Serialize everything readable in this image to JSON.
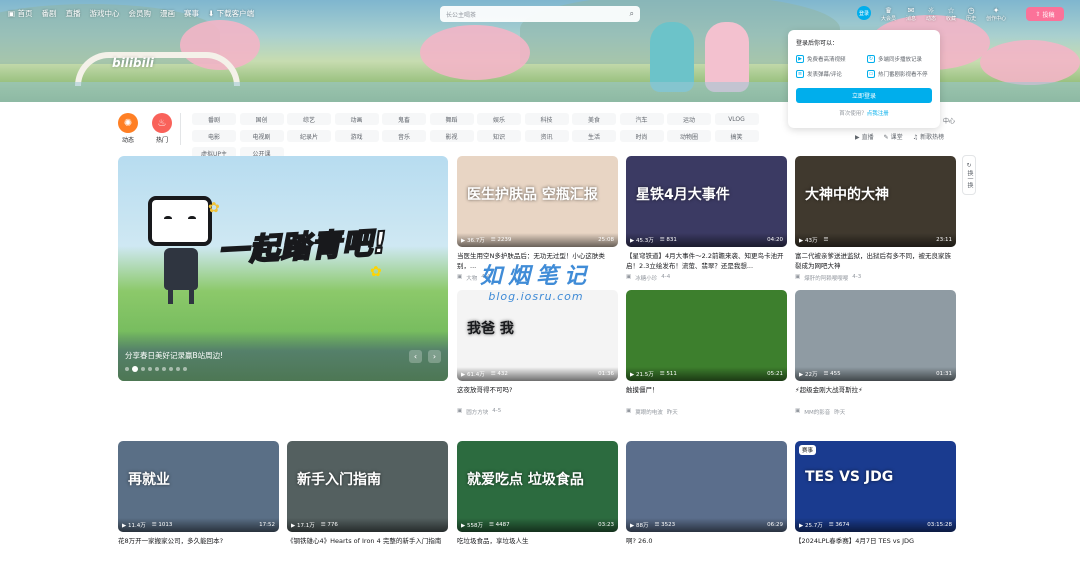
{
  "nav": {
    "items": [
      "首页",
      "番剧",
      "直播",
      "游戏中心",
      "会员购",
      "漫画",
      "赛事",
      "下载客户端"
    ],
    "search_placeholder": "长公主喝茶",
    "login_label": "登录",
    "right_items": [
      "大会员",
      "消息",
      "动态",
      "收藏",
      "历史",
      "创作中心"
    ],
    "upload_label": "投稿"
  },
  "logo_text": "bilibili",
  "channels": [
    {
      "label": "动态",
      "color": "#ff7f24"
    },
    {
      "label": "热门",
      "color": "#f9625a"
    }
  ],
  "tags": [
    "番剧",
    "国创",
    "综艺",
    "动画",
    "鬼畜",
    "舞蹈",
    "娱乐",
    "科技",
    "美食",
    "汽车",
    "运动",
    "VLOG",
    "电影",
    "电视剧",
    "纪录片",
    "游戏",
    "音乐",
    "影视",
    "知识",
    "资讯",
    "生活",
    "时尚",
    "动物圈",
    "搞笑",
    "虚拟UP主",
    "公开课"
  ],
  "extra_links": [
    "直播",
    "课堂",
    "新歌热榜"
  ],
  "popup": {
    "title": "登录后你可以：",
    "features": [
      "免费看高清视频",
      "多端同步播放记录",
      "发表弹幕/评论",
      "热门番剧影视看不停"
    ],
    "login_button": "立即登录",
    "register_prefix": "首次使用？",
    "register_link": "点我注册",
    "right_text": "中心"
  },
  "carousel": {
    "slogan": "一起踏青吧!",
    "caption": "分享春日美好记录赢B站周边!",
    "dots": 9,
    "active_dot": 1
  },
  "refresh_label": "换一换",
  "watermark": {
    "big": "如烟笔记",
    "small": "blog.iosru.com"
  },
  "cards": [
    {
      "views": "36.7万",
      "danmaku": "2239",
      "duration": "25:08",
      "title": "当医生用空N多护肤品后：无功无过型！小心这肤类别，...",
      "author": "大物",
      "date": "4-4",
      "thumb_text": "医生护肤品 空瓶汇报",
      "thumb_bg": "#e8d5c4"
    },
    {
      "views": "45.3万",
      "danmaku": "831",
      "duration": "04:20",
      "title": "【星穹铁道】4月大事件～2.2前瞻来袭、知更鸟卡池开启！2.3立绘发布！流萤、翡翠？还是我想...",
      "author": "冰糖小珍",
      "date": "4-4",
      "thumb_text": "星铁4月大事件",
      "thumb_bg": "#3b3a63"
    },
    {
      "views": "43万",
      "danmaku": "",
      "duration": "23:11",
      "title": "富二代被亲爹送进监狱，出狱后有多不同，被无良家族裂成为网吧大神",
      "author": "爆肝的阿赖嘤嘤嘤",
      "date": "4-3",
      "thumb_text": "大神中的大神",
      "thumb_bg": "#40392e"
    },
    {
      "views": "61.4万",
      "danmaku": "432",
      "duration": "01:36",
      "title": "这夜放哥得不可吗?",
      "author": "圆方方块",
      "date": "4-5",
      "thumb_text": "我爸 我",
      "thumb_bg": "#f4f4f4"
    },
    {
      "views": "21.5万",
      "danmaku": "511",
      "duration": "05:21",
      "title": "触摸僵尸！",
      "author": "翼眼的电波",
      "date": "昨天",
      "thumb_text": "",
      "thumb_bg": "#3d7f2d"
    },
    {
      "views": "22万",
      "danmaku": "455",
      "duration": "01:31",
      "title": "⚡超级金刚大战哥斯拉⚡",
      "author": "MM的影音",
      "date": "昨天",
      "thumb_text": "",
      "thumb_bg": "#8f9ba3"
    },
    {
      "views": "11.4万",
      "danmaku": "1013",
      "duration": "17:52",
      "title": "花8万开一家搬家公司，多久能回本?",
      "author": "",
      "date": "",
      "thumb_text": "再就业",
      "thumb_bg": "#5a6f86"
    },
    {
      "views": "17.1万",
      "danmaku": "776",
      "duration": "",
      "title": "《钢铁雄心4》Hearts of Iron 4 完整的新手入门指南",
      "author": "",
      "date": "",
      "thumb_text": "新手入门指南",
      "thumb_bg": "#546060"
    },
    {
      "views": "558万",
      "danmaku": "4487",
      "duration": "03:23",
      "title": "吃垃圾食品，享垃圾人生",
      "author": "",
      "date": "",
      "thumb_text": "就爱吃点 垃圾食品",
      "thumb_bg": "#2c6b3f"
    },
    {
      "views": "88万",
      "danmaku": "3523",
      "duration": "06:29",
      "title": "啊? 26.0",
      "author": "",
      "date": "",
      "thumb_text": "",
      "thumb_bg": "#5b6e8c"
    },
    {
      "views": "25.7万",
      "danmaku": "3674",
      "duration": "03:15:28",
      "title": "【2024LPL春季赛】4月7日 TES vs JDG",
      "author": "",
      "date": "",
      "thumb_text": "TES VS JDG",
      "thumb_bg": "#1a3b8f",
      "live_tag": "赛事"
    }
  ]
}
